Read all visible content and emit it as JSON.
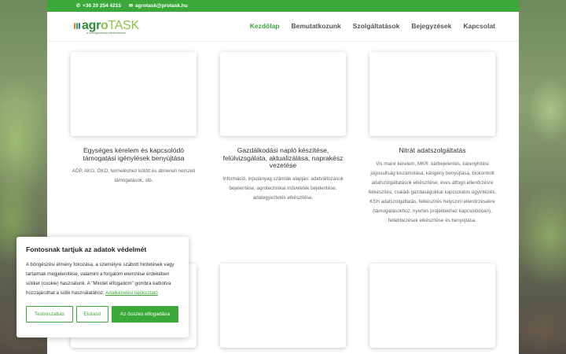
{
  "topbar": {
    "phone": "+36 20 254 4215",
    "email": "agrotask@protask.hu"
  },
  "logo": {
    "text_agro": "agr",
    "text_o": "o",
    "text_task": "TASK",
    "tagline": "a mezőgazdaság adminisztráció",
    "bar_colors": [
      "#e57b2a",
      "#3ba83a",
      "#2f7dc3"
    ]
  },
  "nav": {
    "items": [
      {
        "label": "Kezdőlap",
        "active": true
      },
      {
        "label": "Bemutatkozunk",
        "active": false
      },
      {
        "label": "Szolgáltatások",
        "active": false
      },
      {
        "label": "Bejegyzések",
        "active": false
      },
      {
        "label": "Kapcsolat",
        "active": false
      }
    ]
  },
  "services": [
    {
      "title": "Egységes kérelem és kapcsolódó támogatási igénylések benyújtása",
      "desc": "AÖP, AKG, ÖKO, termeléshez kötött és átmeneti nemzeti támogatások, stb."
    },
    {
      "title": "Gazdálkodási napló készítése, felülvizsgálata, aktualizálása, naprakész vezetése",
      "desc": "Információ, inputanyag számlák alapján: adatváltozások bejelentése, agrotechnikai műveletek bejelentése, adategyeztetés elkészítése."
    },
    {
      "title": "Nitrát adatszolgáltatás",
      "desc": "Vis maior kérelem, MKR: kárbejelentés, kárenyhítési jogosultság kiszámolása, kárigény benyújtása, biokontroll adatszolgáltatások elkészítése, éves átfogó ellenőrzésre felkészítés, családi gazdaságokkal kapcsolatos ügyintézés, KSH adatszolgáltatás, felkészítés helyszíni ellenőrzésekre (támogatásokhoz, nyertes projektekhez kapcsolódóan), fellebbezések elkészítése és benyújtása."
    }
  ],
  "cookie": {
    "title": "Fontosnak tartjuk az adatok védelmét",
    "text": "A böngészési élmény fokozása, a személyre szabott hirdetések vagy tartalmak megjelenítése, valamint a forgalom elemzése érdekében sütiket (cookie) használunk. A \"Mindet elfogadom\" gombra kattintva hozzájárulhat a sütik használatához.",
    "policy_link": "Adatkezelési tájékoztató",
    "buttons": {
      "customize": "Testreszabás",
      "reject": "Elutasít",
      "accept_all": "Az összes elfogadása"
    }
  },
  "colors": {
    "brand_green": "#3ba83a",
    "logo_dark_green": "#2e8b3a",
    "logo_light_green": "#8cc34a"
  }
}
